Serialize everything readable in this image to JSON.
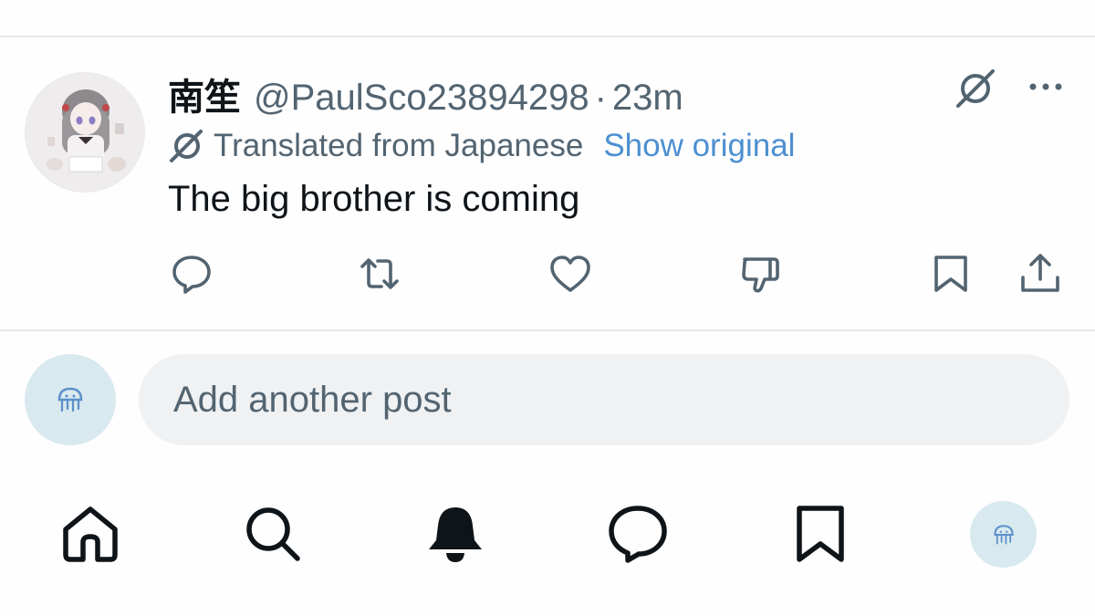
{
  "post": {
    "display_name": "南笙",
    "handle": "@PaulSco23894298",
    "separator": "·",
    "time": "23m",
    "translated_label": "Translated from Japanese",
    "show_original_label": "Show original",
    "text": "The big brother is coming"
  },
  "actions": [
    "reply-icon",
    "repost-icon",
    "like-icon",
    "dislike-icon",
    "bookmark-icon",
    "share-icon"
  ],
  "composer": {
    "placeholder": "Add another post"
  },
  "nav": [
    "home-icon",
    "search-icon",
    "notifications-icon",
    "messages-icon",
    "bookmarks-icon",
    "profile-avatar"
  ],
  "colors": {
    "text": "#0f1419",
    "muted": "#536471",
    "link": "#4d8fd1",
    "input_bg": "#eff1f3",
    "avatar_bg": "#d8e9ef"
  }
}
